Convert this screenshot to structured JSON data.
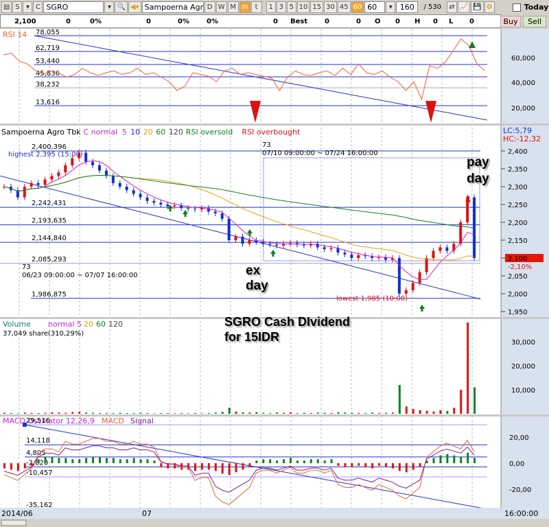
{
  "toolbar": {
    "s": "S",
    "c": "C",
    "symbol": "SGRO",
    "name": "Sampoerna Agro",
    "periods": [
      "D",
      "W",
      "M",
      "m",
      "t"
    ],
    "active_period": "m",
    "intervals": [
      "1",
      "3",
      "5",
      "10",
      "15",
      "30",
      "45",
      "60"
    ],
    "active_interval": "60",
    "interval_value": "60",
    "count": "160",
    "total": "/ 530",
    "today_label": "Today"
  },
  "info": {
    "price": "2,100",
    "v1": "0",
    "p1": "0%",
    "v2": "0",
    "p2": "0%",
    "p3": "0%",
    "v3": "0",
    "best": "Best",
    "b1": "0",
    "b2": "0",
    "o": "O",
    "ov": "0",
    "h": "H",
    "hv": "0",
    "l": "L",
    "lv": "0"
  },
  "buttons": {
    "buy": "Buy",
    "sell": "Sell"
  },
  "rsi": {
    "title": "RSI 14",
    "levels": [
      "78,055",
      "62,719",
      "53,440",
      "45,836",
      "38,232",
      "13,616"
    ],
    "axis": [
      "60,000",
      "40,000",
      "20,000"
    ]
  },
  "price": {
    "legend": {
      "name": "Sampoerna Agro Tbk",
      "c": "C normal",
      "ma5": "5",
      "ma10": "10",
      "ma20": "20",
      "ma60": "60",
      "ma120": "120",
      "rsi_os": "RSI oversold",
      "rsi_ob": "RSI overbought"
    },
    "levels": [
      "2,400,396",
      "2,242,431",
      "2,193,635",
      "2,144,840",
      "2,085,293",
      "1,986,875"
    ],
    "highest": "highest 2,395 (15:00)",
    "lowest": "lowest 1,985 (10:00)",
    "range1_count": "73",
    "range1": "06/23 09:00:00 ~ 07/07 16:00:00",
    "range2_count": "73",
    "range2": "07/10 09:00:00 ~ 07/24 16:00:00",
    "lc": "LC:5,79",
    "hc": "HC:-12,32",
    "current": "2,100",
    "change": "-2,10%",
    "axis": [
      "2,400",
      "2,350",
      "2,300",
      "2,250",
      "2,200",
      "2,150",
      "2,100",
      "2,050",
      "2,000",
      "1,950"
    ]
  },
  "annotations": {
    "ex1": "ex",
    "ex2": "day",
    "pay1": "pay",
    "pay2": "day",
    "title1": "SGRO Cash DIvidend",
    "title2": "for 15IDR"
  },
  "volume": {
    "legend": {
      "name": "Volume",
      "normal": "normal 5",
      "ma20": "20",
      "ma60": "60",
      "ma120": "120"
    },
    "info": "37,049 share(310,29%)",
    "axis": [
      "30,000",
      "20,000",
      "10,000"
    ]
  },
  "macd": {
    "legend": {
      "name": "MACD Oscillator 12,26,9",
      "macd": "MACD",
      "signal": "Signal"
    },
    "levels": [
      "29,516",
      "14,118",
      "4,805",
      "-2,820",
      "-10,457",
      "-35,162"
    ],
    "axis": [
      "20,00",
      "0,00",
      "-20,00"
    ]
  },
  "dates": {
    "d1": "2014/06",
    "d2": "07",
    "time": "16:00:00"
  },
  "chart_data": {
    "type": "candlestick",
    "closes": [
      2300,
      2290,
      2270,
      2300,
      2310,
      2305,
      2320,
      2330,
      2340,
      2360,
      2380,
      2395,
      2370,
      2360,
      2345,
      2330,
      2310,
      2300,
      2290,
      2280,
      2270,
      2260,
      2255,
      2250,
      2245,
      2248,
      2240,
      2238,
      2236,
      2240,
      2230,
      2225,
      2210,
      2150,
      2160,
      2140,
      2150,
      2145,
      2140,
      2138,
      2135,
      2140,
      2142,
      2138,
      2135,
      2140,
      2130,
      2125,
      2128,
      2115,
      2110,
      2100,
      2108,
      2105,
      2100,
      2102,
      2095,
      2100,
      2000,
      2010,
      2030,
      2060,
      2100,
      2120,
      2130,
      2120,
      2140,
      2200,
      2270,
      2100
    ],
    "volumes": [
      400,
      300,
      200,
      500,
      300,
      300,
      400,
      600,
      500,
      400,
      700,
      900,
      500,
      400,
      300,
      300,
      300,
      400,
      300,
      300,
      400,
      300,
      200,
      300,
      300,
      200,
      300,
      200,
      300,
      200,
      300,
      500,
      800,
      2500,
      900,
      600,
      500,
      700,
      400,
      300,
      500,
      400,
      600,
      300,
      400,
      300,
      500,
      400,
      300,
      600,
      500,
      400,
      300,
      300,
      500,
      300,
      400,
      500,
      12000,
      3000,
      2000,
      1500,
      1200,
      900,
      1500,
      1200,
      2500,
      10000,
      38000,
      11000
    ],
    "colors": {
      "up": "#e01010",
      "down": "#1030d0"
    }
  }
}
